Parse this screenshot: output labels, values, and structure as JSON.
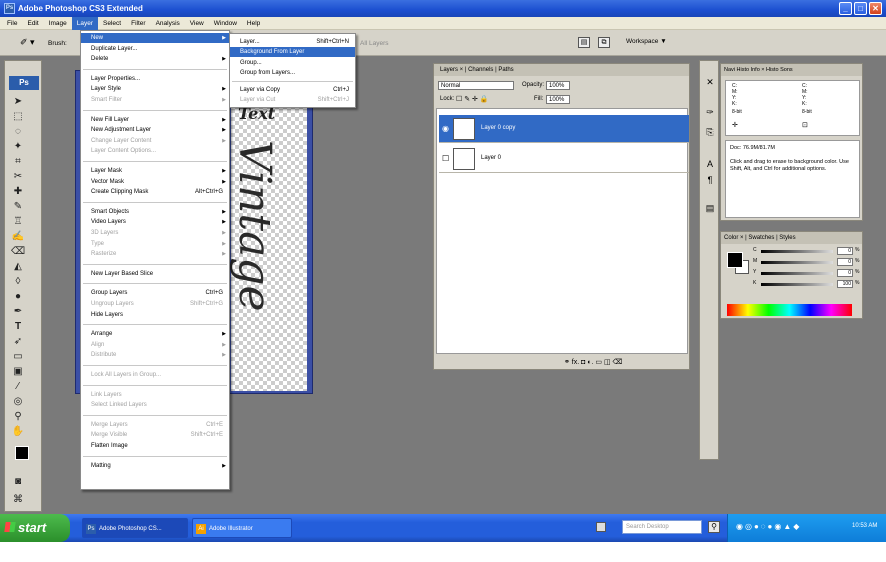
{
  "window": {
    "title": "Adobe Photoshop CS3 Extended",
    "icon": "Ps"
  },
  "menubar": [
    "File",
    "Edit",
    "Image",
    "Layer",
    "Select",
    "Filter",
    "Analysis",
    "View",
    "Window",
    "Help"
  ],
  "options": {
    "brush_label": "Brush:",
    "faded_label": "All Layers",
    "workspace": "Workspace ▼"
  },
  "toolbox": {
    "logo": "Ps"
  },
  "document": {
    "text": "Vintage",
    "header_text": "Text"
  },
  "layer_menu": {
    "items": [
      {
        "label": "New",
        "shortcut": "",
        "submenu": true,
        "disabled": false,
        "highlight": true
      },
      {
        "label": "Duplicate Layer...",
        "shortcut": "",
        "submenu": false,
        "disabled": false
      },
      {
        "label": "Delete",
        "shortcut": "",
        "submenu": true,
        "disabled": false
      },
      {
        "label": "Layer Properties...",
        "shortcut": "",
        "submenu": false,
        "disabled": false
      },
      {
        "label": "Layer Style",
        "shortcut": "",
        "submenu": true,
        "disabled": false
      },
      {
        "label": "Smart Filter",
        "shortcut": "",
        "submenu": true,
        "disabled": true
      },
      {
        "label": "New Fill Layer",
        "shortcut": "",
        "submenu": true,
        "disabled": false
      },
      {
        "label": "New Adjustment Layer",
        "shortcut": "",
        "submenu": true,
        "disabled": false
      },
      {
        "label": "Change Layer Content",
        "shortcut": "",
        "submenu": true,
        "disabled": true
      },
      {
        "label": "Layer Content Options...",
        "shortcut": "",
        "submenu": false,
        "disabled": true
      },
      {
        "label": "Layer Mask",
        "shortcut": "",
        "submenu": true,
        "disabled": false
      },
      {
        "label": "Vector Mask",
        "shortcut": "",
        "submenu": true,
        "disabled": false
      },
      {
        "label": "Create Clipping Mask",
        "shortcut": "Alt+Ctrl+G",
        "submenu": false,
        "disabled": false
      },
      {
        "label": "Smart Objects",
        "shortcut": "",
        "submenu": true,
        "disabled": false
      },
      {
        "label": "Video Layers",
        "shortcut": "",
        "submenu": true,
        "disabled": false
      },
      {
        "label": "3D Layers",
        "shortcut": "",
        "submenu": true,
        "disabled": true
      },
      {
        "label": "Type",
        "shortcut": "",
        "submenu": true,
        "disabled": true
      },
      {
        "label": "Rasterize",
        "shortcut": "",
        "submenu": true,
        "disabled": true
      },
      {
        "label": "New Layer Based Slice",
        "shortcut": "",
        "submenu": false,
        "disabled": false
      },
      {
        "label": "Group Layers",
        "shortcut": "Ctrl+G",
        "submenu": false,
        "disabled": false
      },
      {
        "label": "Ungroup Layers",
        "shortcut": "Shift+Ctrl+G",
        "submenu": false,
        "disabled": true
      },
      {
        "label": "Hide Layers",
        "shortcut": "",
        "submenu": false,
        "disabled": false
      },
      {
        "label": "Arrange",
        "shortcut": "",
        "submenu": true,
        "disabled": false
      },
      {
        "label": "Align",
        "shortcut": "",
        "submenu": true,
        "disabled": true
      },
      {
        "label": "Distribute",
        "shortcut": "",
        "submenu": true,
        "disabled": true
      },
      {
        "label": "Lock All Layers in Group...",
        "shortcut": "",
        "submenu": false,
        "disabled": true
      },
      {
        "label": "Link Layers",
        "shortcut": "",
        "submenu": false,
        "disabled": true
      },
      {
        "label": "Select Linked Layers",
        "shortcut": "",
        "submenu": false,
        "disabled": true
      },
      {
        "label": "Merge Layers",
        "shortcut": "Ctrl+E",
        "submenu": false,
        "disabled": true
      },
      {
        "label": "Merge Visible",
        "shortcut": "Shift+Ctrl+E",
        "submenu": false,
        "disabled": true
      },
      {
        "label": "Flatten Image",
        "shortcut": "",
        "submenu": false,
        "disabled": false
      },
      {
        "label": "Matting",
        "shortcut": "",
        "submenu": true,
        "disabled": false
      }
    ]
  },
  "new_submenu": {
    "items": [
      {
        "label": "Layer...",
        "shortcut": "Shift+Ctrl+N",
        "disabled": false,
        "highlight": false
      },
      {
        "label": "Background From Layer",
        "shortcut": "",
        "disabled": false,
        "highlight": true
      },
      {
        "label": "Group...",
        "shortcut": "",
        "disabled": false,
        "highlight": false
      },
      {
        "label": "Group from Layers...",
        "shortcut": "",
        "disabled": false,
        "highlight": false
      },
      {
        "label": "Layer via Copy",
        "shortcut": "Ctrl+J",
        "disabled": false,
        "highlight": false
      },
      {
        "label": "Layer via Cut",
        "shortcut": "Shift+Ctrl+J",
        "disabled": true,
        "highlight": false
      }
    ]
  },
  "layers_panel": {
    "tabs": "Layers × | Channels | Paths",
    "blend_mode": "Normal",
    "opacity_label": "Opacity:",
    "opacity": "100%",
    "lock_label": "Lock:",
    "fill_label": "Fill:",
    "fill": "100%",
    "layers": [
      {
        "name": "Layer 0 copy",
        "selected": true
      },
      {
        "name": "Layer 0",
        "selected": false
      }
    ],
    "footer_icons": "⚭ fx. ◘ ◐. ▭ ◫ ⌫"
  },
  "info_panel": {
    "tabs": "Navi  Histo  Info ×  Histo  Sons",
    "col1": "C:\nM:\nY:\nK:",
    "col2": "C:\nM:\nY:\nK:",
    "bitdepth": "8-bit",
    "doc": "Doc: 76.9M/81.7M",
    "help": "Click and drag to erase to background color.  Use Shift, Alt, and Ctrl for additional options."
  },
  "color_panel": {
    "tabs": "Color × | Swatches | Styles",
    "channels": [
      {
        "label": "C",
        "value": "0"
      },
      {
        "label": "M",
        "value": "0"
      },
      {
        "label": "Y",
        "value": "0"
      },
      {
        "label": "K",
        "value": "100"
      }
    ],
    "unit": "%"
  },
  "taskbar": {
    "start": "start",
    "tasks": [
      "Adobe Photoshop CS...",
      "Adobe Illustrator"
    ],
    "search": "Search Desktop",
    "clock": "10:53 AM"
  }
}
